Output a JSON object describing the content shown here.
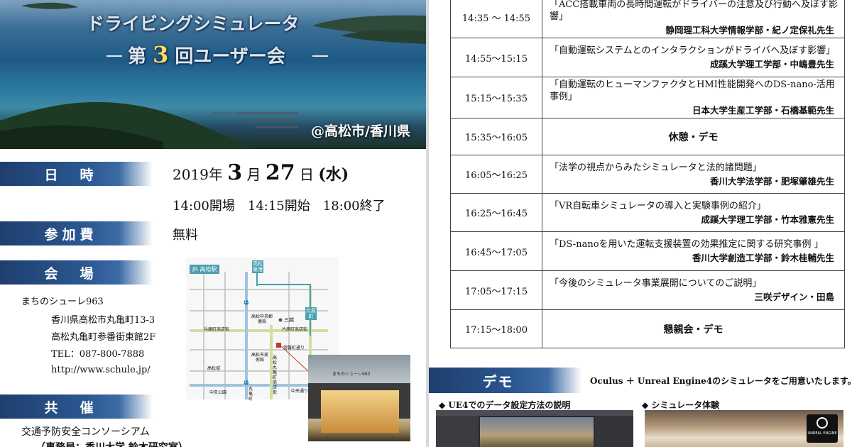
{
  "hero": {
    "title_line1": "ドライビングシミュレータ",
    "title_prefix": "第",
    "title_number": "3",
    "title_suffix": "回ユーザー会",
    "location": "@高松市/香川県"
  },
  "sections": {
    "datetime_label": "日　時",
    "fee_label": "参加費",
    "venue_label": "会　場",
    "cosponsor_label": "共　催"
  },
  "date": {
    "year": "2019年",
    "month_num": "3",
    "month_unit": "月",
    "day_num": "27",
    "day_unit": "日",
    "weekday": "(水)",
    "times": "14:00開場　14:15開始　18:00終了"
  },
  "fee": {
    "value": "無料"
  },
  "venue": {
    "name": "まちのシューレ963",
    "address1": "香川県高松市丸亀町13-3",
    "address2": "高松丸亀町参番街東館2F",
    "tel": "TEL：087-800-7888",
    "url": "http://www.schule.jp/"
  },
  "map": {
    "jr_label": "JR 高松駅",
    "station1": "高松築港",
    "station2": "片原町",
    "label_sanjo": "三越",
    "label_post": "高松中央郵便局",
    "label_museum": "高松市美術館",
    "label_school": "高松丸亀町商店街",
    "label_park": "中央公園",
    "label_street1": "兵庫町商店街",
    "label_street2": "片原町商店街",
    "label_highway": "中央通り",
    "label_ryoma": "丸亀町",
    "label_koto": "高松城",
    "label_marker": "常磐町通り",
    "route_num1": "11",
    "route_num2": "11",
    "photo_sign": "まちのシューレ963"
  },
  "cosponsor": {
    "name": "交通予防安全コンソーシアム",
    "office": "（事務局：香川大学 鈴木研究室）"
  },
  "schedule": [
    {
      "time": "14:35 ～ 14:55",
      "title": "「ACC搭載車両の長時間運転がドライバーの注意及び行動へ及ぼす影響」",
      "speaker": "静岡理工科大学情報学部・紀ノ定保礼先生"
    },
    {
      "time": "14:55～15:15",
      "title": "「自動運転システムとのインタラクションがドライバへ及ぼす影響」",
      "speaker": "成蹊大学理工学部・中嶋豊先生"
    },
    {
      "time": "15:15～15:35",
      "title": "「自動運転のヒューマンファクタとHMI性能開発へのDS-nano-活用事例」",
      "speaker": "日本大学生産工学部・石橋基範先生"
    },
    {
      "time": "15:35～16:05",
      "center": "休憩・デモ"
    },
    {
      "time": "16:05～16:25",
      "title": "「法学の視点からみたシミュレータと法的諸問題」",
      "speaker": "香川大学法学部・肥塚肇雄先生"
    },
    {
      "time": "16:25～16:45",
      "title": "「VR自転車シミュレータの導入と実験事例の紹介」",
      "speaker": "成蹊大学理工学部・竹本雅憲先生"
    },
    {
      "time": "16:45～17:05",
      "title": "「DS-nanoを用いた運転支援装置の効果推定に関する研究事例 」",
      "speaker": "香川大学創造工学部・鈴木桂輔先生"
    },
    {
      "time": "17:05～17:15",
      "title": "「今後のシミュレータ事業展開についてのご説明」",
      "speaker": "三咲デザイン・田島"
    },
    {
      "time": "17:15～18:00",
      "center": "懇親会・デモ"
    }
  ],
  "demo": {
    "label": "デモ",
    "description": "Oculus ＋ Unreal Engine4のシミュレータをご用意いたします。",
    "caption1": "◆ UE4でのデータ設定方法の説明",
    "caption2": "◆ シミュレータ体験",
    "logo_text": "UNREAL ENGINE"
  },
  "colors": {
    "label_blue": "#2b5791",
    "accent_yellow": "#ffd966"
  }
}
